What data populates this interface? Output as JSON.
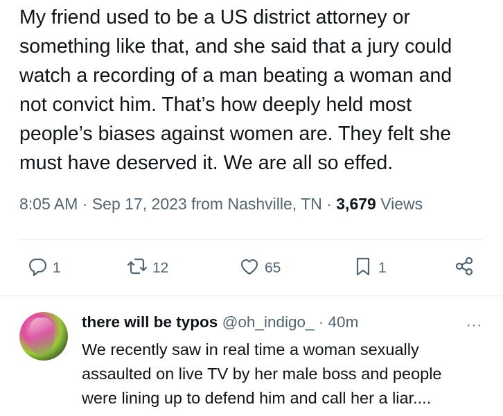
{
  "tweet": {
    "text_lines": [
      "My friend used to be a US district attorney or",
      "something like that, and she said that a jury could",
      "watch a recording of a man beating a woman and",
      "not convict him. That’s how deeply held most",
      "people’s biases against women are. They felt she",
      "must have deserved it. We are all so effed."
    ],
    "time": "8:05 AM",
    "date": "Sep 17, 2023",
    "location": "from Nashville, TN",
    "views_count": "3,679",
    "views_label": "Views",
    "sep": "·"
  },
  "actions": {
    "reply_count": "1",
    "retweet_count": "12",
    "like_count": "65",
    "bookmark_count": "1"
  },
  "reply": {
    "name": "there will be typos",
    "handle": "@oh_indigo_",
    "sep": "·",
    "time": "40m",
    "more": "···",
    "text_lines": [
      "We recently saw in real time a woman sexually",
      "assaulted on live TV by her male boss and people",
      "were lining up to defend him and call her a liar...."
    ]
  },
  "colors": {
    "text": "#0f1419",
    "secondary": "#536471",
    "divider": "#eff3f4"
  }
}
